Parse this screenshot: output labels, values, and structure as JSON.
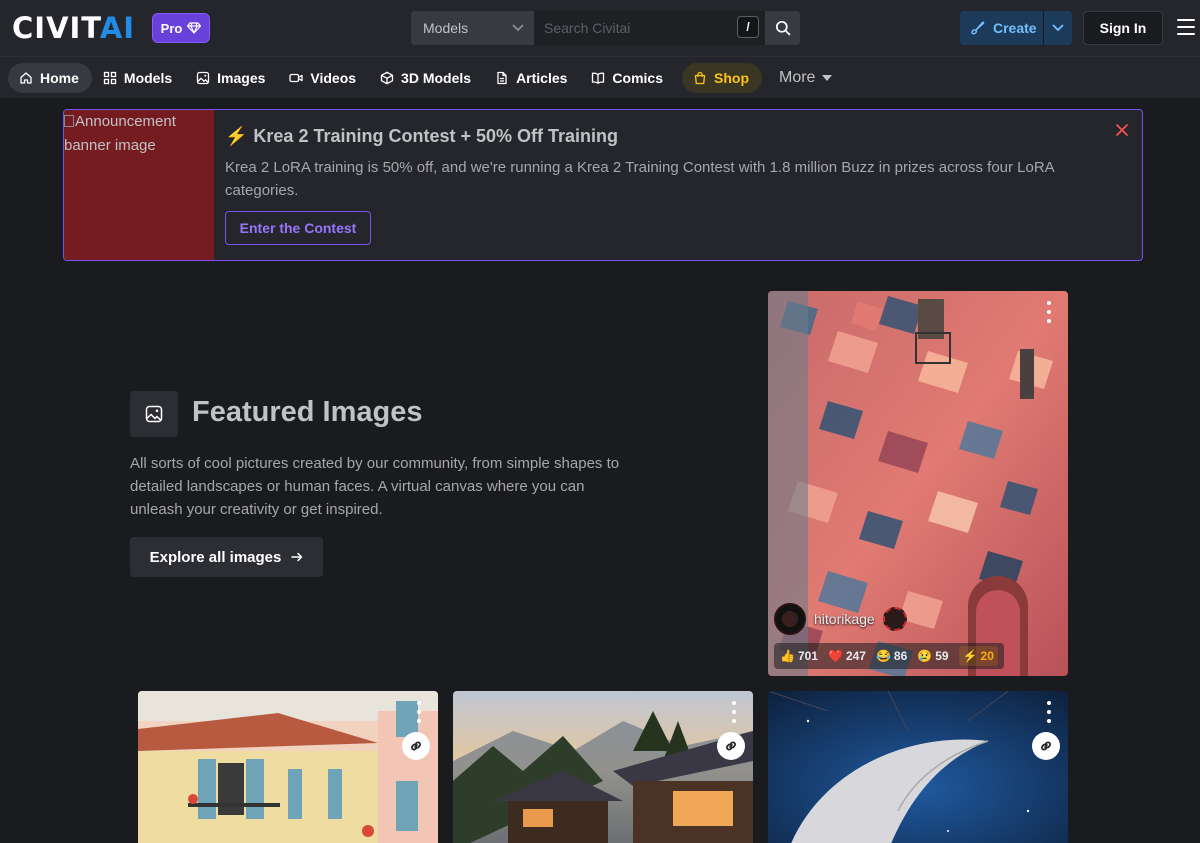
{
  "header": {
    "logo_main": "CIVIT",
    "logo_accent": "AI",
    "pro_label": "Pro",
    "search_type": "Models",
    "search_placeholder": "Search Civitai",
    "search_shortcut": "/",
    "create_label": "Create",
    "signin_label": "Sign In"
  },
  "nav": {
    "items": [
      {
        "label": "Home",
        "icon": "home-icon"
      },
      {
        "label": "Models",
        "icon": "grid-icon"
      },
      {
        "label": "Images",
        "icon": "image-icon"
      },
      {
        "label": "Videos",
        "icon": "video-icon"
      },
      {
        "label": "3D Models",
        "icon": "cube-icon"
      },
      {
        "label": "Articles",
        "icon": "file-icon"
      },
      {
        "label": "Comics",
        "icon": "book-icon"
      },
      {
        "label": "Shop",
        "icon": "shopping-bag-icon"
      },
      {
        "label": "More",
        "icon": "caret-down-icon"
      }
    ],
    "active": "Home"
  },
  "announcement": {
    "image_alt": "Announcement banner image",
    "title": "Krea 2 Training Contest + 50% Off Training",
    "body": "Krea 2 LoRA training is 50% off, and we're running a Krea 2 Training Contest with 1.8 million Buzz in prizes across four LoRA categories.",
    "cta": "Enter the Contest"
  },
  "featured": {
    "title": "Featured Images",
    "description": "All sorts of cool pictures created by our community, from simple shapes to detailed landscapes or human faces. A virtual canvas where you can unleash your creativity or get inspired.",
    "cta": "Explore all images"
  },
  "main_card": {
    "author": "hitorikage",
    "reactions": {
      "like": "701",
      "heart": "247",
      "laugh": "86",
      "cry": "59",
      "buzz": "20"
    }
  },
  "colors": {
    "background": "#1a1b1e",
    "header": "#25262b",
    "pro": "#6741d9",
    "accent": "#228be6",
    "announce_border": "#7950f2",
    "shop": "#fcc419"
  }
}
